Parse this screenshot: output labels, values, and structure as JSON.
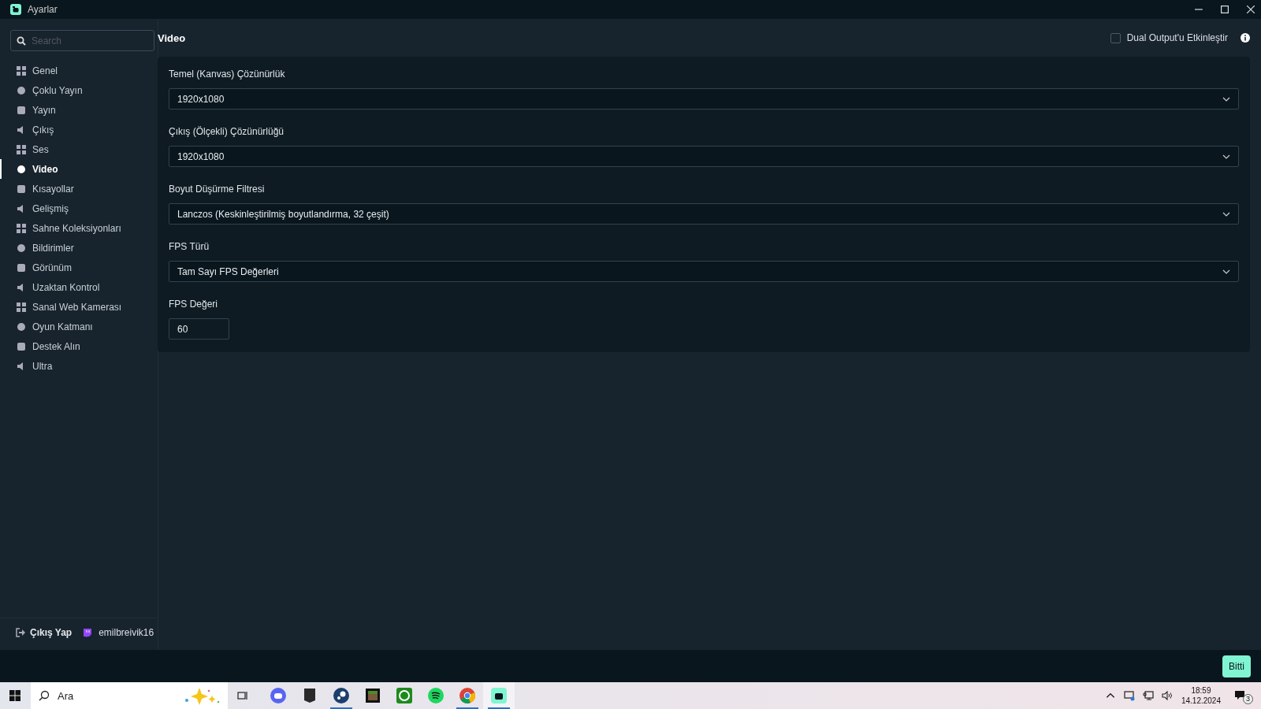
{
  "window": {
    "title": "Ayarlar"
  },
  "sidebar": {
    "search": {
      "placeholder": "Search"
    },
    "items": [
      {
        "label": "Genel",
        "selected": false
      },
      {
        "label": "Çoklu Yayın",
        "selected": false
      },
      {
        "label": "Yayın",
        "selected": false
      },
      {
        "label": "Çıkış",
        "selected": false
      },
      {
        "label": "Ses",
        "selected": false
      },
      {
        "label": "Video",
        "selected": true
      },
      {
        "label": "Kısayollar",
        "selected": false
      },
      {
        "label": "Gelişmiş",
        "selected": false
      },
      {
        "label": "Sahne Koleksiyonları",
        "selected": false
      },
      {
        "label": "Bildirimler",
        "selected": false
      },
      {
        "label": "Görünüm",
        "selected": false
      },
      {
        "label": "Uzaktan Kontrol",
        "selected": false
      },
      {
        "label": "Sanal Web Kamerası",
        "selected": false
      },
      {
        "label": "Oyun Katmanı",
        "selected": false
      },
      {
        "label": "Destek Alın",
        "selected": false
      },
      {
        "label": "Ultra",
        "selected": false
      }
    ],
    "logout": "Çıkış Yap",
    "username": "emilbreivik16"
  },
  "page": {
    "title": "Video",
    "dual_output": {
      "label": "Dual Output'u Etkinleştir",
      "checked": false
    },
    "fields": [
      {
        "kind": "select",
        "label": "Temel (Kanvas) Çözünürlük",
        "value": "1920x1080"
      },
      {
        "kind": "select",
        "label": "Çıkış (Ölçekli) Çözünürlüğü",
        "value": "1920x1080"
      },
      {
        "kind": "select",
        "label": "Boyut Düşürme Filtresi",
        "value": "Lanczos (Keskinleştirilmiş boyutlandırma, 32 çeşit)"
      },
      {
        "kind": "select",
        "label": "FPS Türü",
        "value": "Tam Sayı FPS Değerleri"
      },
      {
        "kind": "number",
        "label": "FPS Değeri",
        "value": "60"
      }
    ]
  },
  "done_button": "Bitti",
  "taskbar": {
    "search": {
      "placeholder": "Ara"
    },
    "apps": [
      {
        "running": false,
        "selected": false
      },
      {
        "running": false,
        "selected": false
      },
      {
        "running": true,
        "selected": false
      },
      {
        "running": false,
        "selected": false
      },
      {
        "running": false,
        "selected": false
      },
      {
        "running": false,
        "selected": false
      },
      {
        "running": true,
        "selected": false
      },
      {
        "running": true,
        "selected": true
      }
    ],
    "time": "18:59",
    "date": "14.12.2024",
    "notifications": "3"
  }
}
